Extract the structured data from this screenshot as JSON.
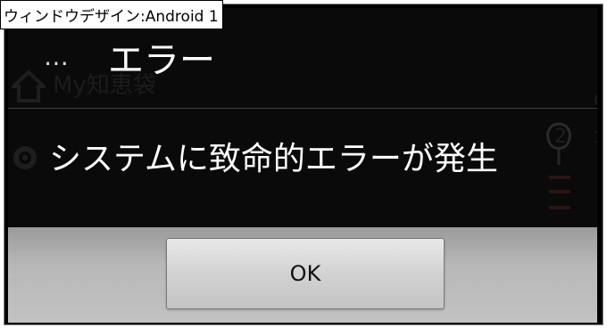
{
  "window": {
    "label": "ウィンドウデザイン:Android 1"
  },
  "dialog": {
    "title": "エラー",
    "message": "システムに致命的エラーが発生",
    "ok_label": "OK",
    "overflow_icon": "⋯"
  },
  "background_app": {
    "title": "My知恵袋",
    "glyph_right_1": "Q",
    "glyph_right_2": "2",
    "glyph_right_3": "か"
  },
  "colors": {
    "dialog_bg": "#0a0a0a",
    "button_area_bg": "#b8b8b8",
    "button_bg": "#d2d2d2",
    "text": "#ffffff"
  }
}
